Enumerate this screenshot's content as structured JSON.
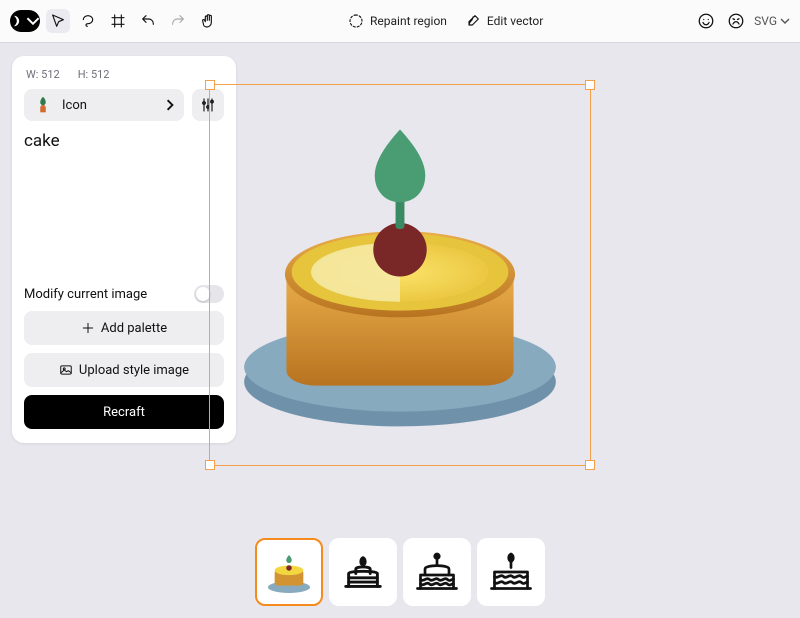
{
  "header": {
    "repaint_label": "Repaint region",
    "editvector_label": "Edit vector",
    "format_label": "SVG"
  },
  "panel": {
    "w_label": "W: 512",
    "h_label": "H: 512",
    "style_label": "Icon",
    "prompt": "cake",
    "modify_label": "Modify current image",
    "add_palette_label": "Add palette",
    "upload_style_label": "Upload style image",
    "generate_label": "Recraft"
  }
}
